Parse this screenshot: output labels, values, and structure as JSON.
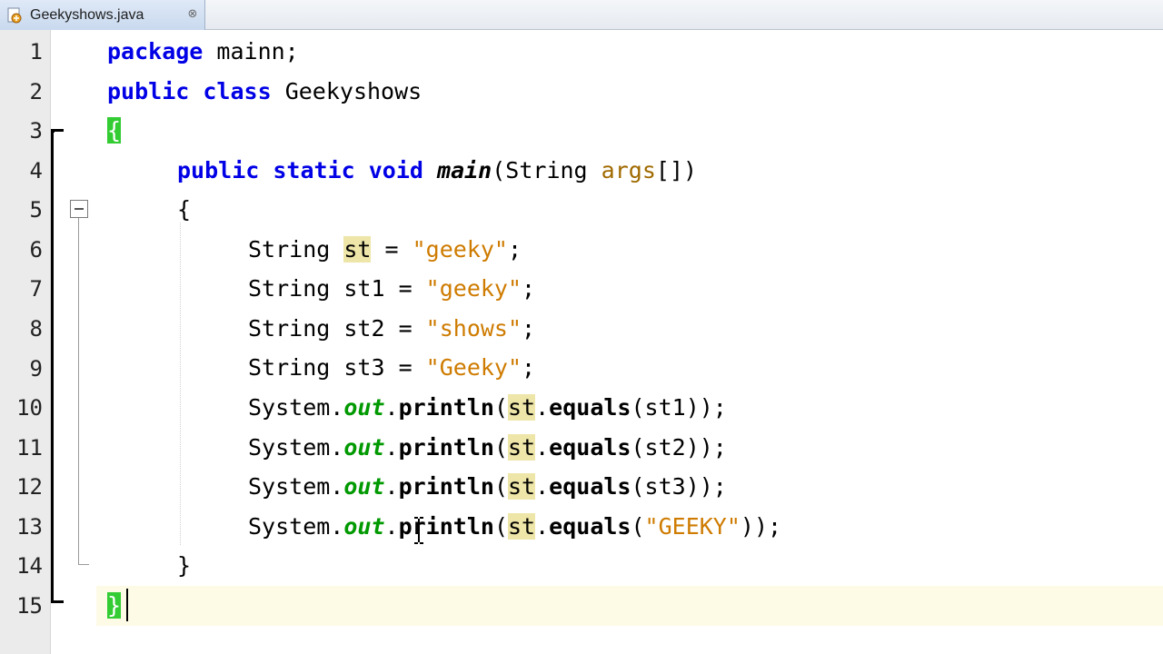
{
  "tab": {
    "title": "Geekyshows.java",
    "close": "⊗"
  },
  "gutter": {
    "line_numbers": [
      "1",
      "2",
      "3",
      "4",
      "5",
      "6",
      "7",
      "8",
      "9",
      "10",
      "11",
      "12",
      "13",
      "14",
      "15"
    ]
  },
  "code": {
    "l1": {
      "kw": "package",
      "rest": " mainn;"
    },
    "l2": {
      "kw1": "public",
      "kw2": "class",
      "name": " Geekyshows"
    },
    "l3": {
      "brace": "{"
    },
    "l4": {
      "kw1": "public",
      "kw2": "static",
      "kw3": "void",
      "method": "main",
      "p1": "(String ",
      "param": "args",
      "p2": "[])"
    },
    "l5": {
      "brace": "{"
    },
    "l6": {
      "type": "String ",
      "var": "st",
      "eq": " = ",
      "str": "\"geeky\"",
      "end": ";"
    },
    "l7": {
      "type": "String st1 = ",
      "str": "\"geeky\"",
      "end": ";"
    },
    "l8": {
      "type": "String st2 = ",
      "str": "\"shows\"",
      "end": ";"
    },
    "l9": {
      "type": "String st3 = ",
      "str": "\"Geeky\"",
      "end": ";"
    },
    "l10": {
      "sys": "System.",
      "out": "out",
      "dot": ".",
      "println": "println",
      "open": "(",
      "st": "st",
      "dot2": ".",
      "equals": "equals",
      "arg": "(st1));"
    },
    "l11": {
      "sys": "System.",
      "out": "out",
      "dot": ".",
      "println": "println",
      "open": "(",
      "st": "st",
      "dot2": ".",
      "equals": "equals",
      "arg": "(st2));"
    },
    "l12": {
      "sys": "System.",
      "out": "out",
      "dot": ".",
      "println": "println",
      "open": "(",
      "st": "st",
      "dot2": ".",
      "equals": "equals",
      "arg": "(st3));"
    },
    "l13": {
      "sys": "System.",
      "out": "out",
      "dot": ".",
      "println": "println",
      "open": "(",
      "st": "st",
      "dot2": ".",
      "equals": "equals",
      "argopen": "(",
      "str": "\"GEEKY\"",
      "argclose": "));"
    },
    "l14": {
      "brace": "}"
    },
    "l15": {
      "brace": "}"
    }
  },
  "colors": {
    "keyword": "#0000e6",
    "string": "#ce7b00",
    "field": "#009900",
    "occurrence": "#eee5a8",
    "brace_match": "#33cc33"
  },
  "icons": {
    "tab": "java-file-icon",
    "close": "close-icon",
    "fold": "fold-collapse-icon",
    "cursor": "text-cursor-icon"
  }
}
